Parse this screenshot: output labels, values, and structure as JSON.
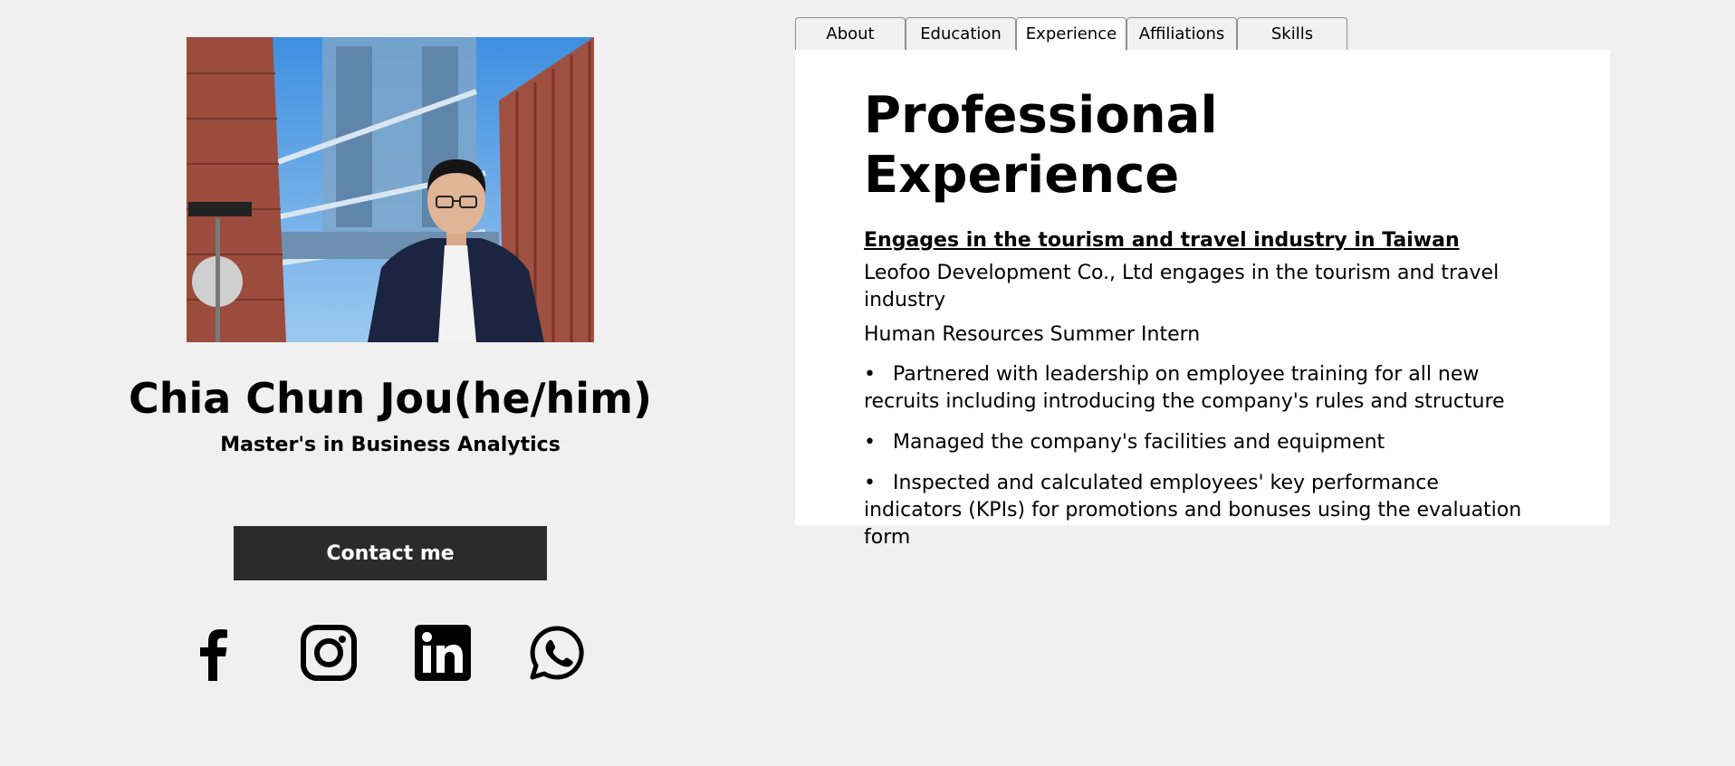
{
  "profile": {
    "name": "Chia Chun Jou(he/him)",
    "degree": "Master's in Business Analytics",
    "contact_label": "Contact me",
    "socials": [
      {
        "icon": "facebook-icon"
      },
      {
        "icon": "instagram-icon"
      },
      {
        "icon": "linkedin-icon"
      },
      {
        "icon": "whatsapp-icon"
      }
    ]
  },
  "tabs": [
    {
      "label": "About"
    },
    {
      "label": "Education"
    },
    {
      "label": "Experience",
      "active": true
    },
    {
      "label": "Affiliations"
    },
    {
      "label": "Skills"
    }
  ],
  "experience": {
    "heading": "Professional Experience",
    "subheading": "Engages in the tourism and travel industry in Taiwan",
    "company": "Leofoo Development Co., Ltd engages in the tourism and travel industry",
    "role": "Human Resources Summer Intern",
    "bullets": [
      "Partnered with leadership on employee training for all new recruits including introducing the company's rules and structure",
      "Managed the company's facilities and equipment",
      "Inspected and calculated employees' key performance indicators (KPIs) for promotions and bonuses using the evaluation form"
    ]
  },
  "colors": {
    "page_background": "#f0f0f0",
    "panel_background": "#ffffff",
    "button_background": "#2b2b2b",
    "button_text": "#ffffff"
  }
}
